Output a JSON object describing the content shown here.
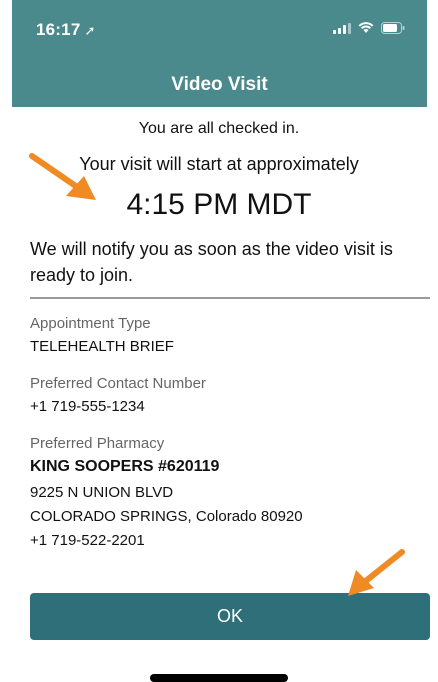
{
  "status_bar": {
    "time": "16:17",
    "icons": [
      "location-arrow-icon",
      "signal-icon",
      "wifi-icon",
      "battery-icon"
    ]
  },
  "header": {
    "title": "Video Visit"
  },
  "checkin": {
    "checked_in": "You are all checked in.",
    "start_text": "Your visit will start at approximately",
    "start_time": "4:15 PM MDT",
    "notify_text": "We will notify you as soon as the video visit is ready to join."
  },
  "details": {
    "appointment_type": {
      "label": "Appointment Type",
      "value": "TELEHEALTH BRIEF"
    },
    "contact_number": {
      "label": "Preferred Contact Number",
      "value": "+1 719-555-1234"
    },
    "pharmacy": {
      "label": "Preferred Pharmacy",
      "name": "KING SOOPERS #620119",
      "address_line1": "9225 N UNION BLVD",
      "address_line2": "COLORADO SPRINGS, Colorado  80920",
      "phone": "+1 719-522-2201"
    }
  },
  "actions": {
    "ok_label": "OK"
  },
  "colors": {
    "header": "#4a8a8d",
    "button": "#2f6f79",
    "annotation_arrow": "#f08a24"
  }
}
